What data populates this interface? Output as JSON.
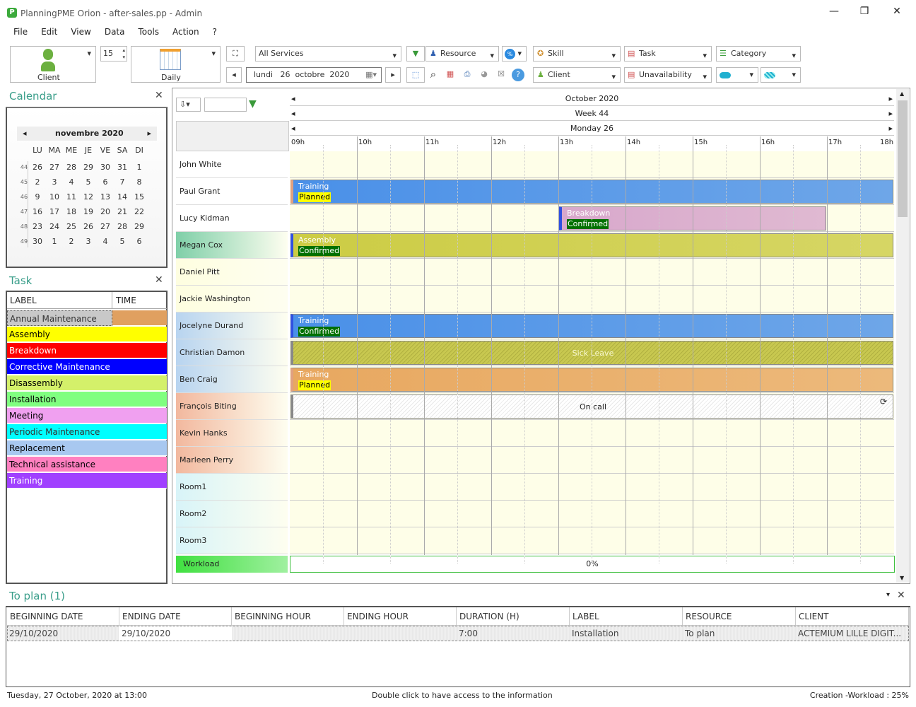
{
  "window": {
    "title": "PlanningPME Orion - after-sales.pp - Admin",
    "minimize": "—",
    "restore": "❐",
    "close": "✕"
  },
  "menu": [
    "File",
    "Edit",
    "View",
    "Data",
    "Tools",
    "Action",
    "?"
  ],
  "toolbar": {
    "client_label": "Client",
    "spin_value": "15",
    "view_label": "Daily",
    "services": "All Services",
    "resource": "Resource",
    "skill": "Skill",
    "task": "Task",
    "category": "Category",
    "client_filter": "Client",
    "unavailability": "Unavailability",
    "date": {
      "day_name": "lundi",
      "day": "26",
      "month": "octobre",
      "year": "2020"
    }
  },
  "calendar": {
    "title": "Calendar",
    "month_label": "novembre 2020",
    "weekdays": [
      "LU",
      "MA",
      "ME",
      "JE",
      "VE",
      "SA",
      "DI"
    ],
    "weeks": [
      {
        "n": "44",
        "d": [
          "26",
          "27",
          "28",
          "29",
          "30",
          "31",
          "1"
        ]
      },
      {
        "n": "45",
        "d": [
          "2",
          "3",
          "4",
          "5",
          "6",
          "7",
          "8"
        ]
      },
      {
        "n": "46",
        "d": [
          "9",
          "10",
          "11",
          "12",
          "13",
          "14",
          "15"
        ]
      },
      {
        "n": "47",
        "d": [
          "16",
          "17",
          "18",
          "19",
          "20",
          "21",
          "22"
        ]
      },
      {
        "n": "48",
        "d": [
          "23",
          "24",
          "25",
          "26",
          "27",
          "28",
          "29"
        ]
      },
      {
        "n": "49",
        "d": [
          "30",
          "1",
          "2",
          "3",
          "4",
          "5",
          "6"
        ]
      }
    ]
  },
  "task_panel": {
    "title": "Task",
    "col_label": "LABEL",
    "col_time": "TIME",
    "items": [
      {
        "label": "Annual Maintenance",
        "color": "#c8c8c8",
        "fg": "#333"
      },
      {
        "label": "Assembly",
        "color": "#ffff00",
        "fg": "#000"
      },
      {
        "label": "Breakdown",
        "color": "#ff0000",
        "fg": "#fff"
      },
      {
        "label": "Corrective Maintenance",
        "color": "#0000ff",
        "fg": "#fff"
      },
      {
        "label": "Disassembly",
        "color": "#d4f06a",
        "fg": "#000"
      },
      {
        "label": "Installation",
        "color": "#80ff80",
        "fg": "#000"
      },
      {
        "label": "Meeting",
        "color": "#f0a0f0",
        "fg": "#000"
      },
      {
        "label": "Periodic Maintenance",
        "color": "#00ffff",
        "fg": "#333"
      },
      {
        "label": "Replacement",
        "color": "#a8c8f0",
        "fg": "#000"
      },
      {
        "label": "Technical assistance",
        "color": "#ff80c0",
        "fg": "#000"
      },
      {
        "label": "Training",
        "color": "#a040ff",
        "fg": "#fff"
      }
    ]
  },
  "planning": {
    "month": "October 2020",
    "week": "Week 44",
    "day": "Monday 26",
    "hours": [
      "09h",
      "10h",
      "11h",
      "12h",
      "13h",
      "14h",
      "15h",
      "16h",
      "17h",
      "18h"
    ],
    "resources": [
      {
        "name": "John White",
        "bg": "#ffffff"
      },
      {
        "name": "Paul Grant",
        "bg": "#ffffff"
      },
      {
        "name": "Lucy Kidman",
        "bg": "#ffffff"
      },
      {
        "name": "Megan Cox",
        "bg": "#7fcfa8"
      },
      {
        "name": "Daniel Pitt",
        "bg": "#fefee0"
      },
      {
        "name": "Jackie Washington",
        "bg": "#fefee0"
      },
      {
        "name": "Jocelyne Durand",
        "bg": "#b8d4f0"
      },
      {
        "name": "Christian Damon",
        "bg": "#b8d4f0"
      },
      {
        "name": "Ben Craig",
        "bg": "#b8d4f0"
      },
      {
        "name": "François Biting",
        "bg": "#f2b89e"
      },
      {
        "name": "Kevin Hanks",
        "bg": "#f2b89e"
      },
      {
        "name": "Marleen Perry",
        "bg": "#f2b89e"
      },
      {
        "name": "Room1",
        "bg": "#d8f4f8"
      },
      {
        "name": "Room2",
        "bg": "#d8f4f8"
      },
      {
        "name": "Room3",
        "bg": "#d8f4f8"
      }
    ],
    "events": [
      {
        "row": 1,
        "start": 9,
        "end": 18,
        "label": "Training",
        "status": "Planned",
        "color": "#4a90e8",
        "status_bg": "#ffff00",
        "status_fg": "#000"
      },
      {
        "row": 2,
        "start": 13,
        "end": 17,
        "label": "Breakdown",
        "status": "Confirmed",
        "color": "#d8a8cc",
        "status_bg": "#007000",
        "status_fg": "#fff"
      },
      {
        "row": 3,
        "start": 9,
        "end": 18,
        "label": "Assembly",
        "status": "Confirmed",
        "color": "#cccc44",
        "status_bg": "#007000",
        "status_fg": "#fff"
      },
      {
        "row": 6,
        "start": 9,
        "end": 18,
        "label": "Training",
        "status": "Confirmed",
        "color": "#4a90e8",
        "status_bg": "#007000",
        "status_fg": "#fff"
      },
      {
        "row": 7,
        "start": 9,
        "end": 18,
        "label": "Sick Leave",
        "status": "",
        "color": "#c8c850",
        "hatched": true
      },
      {
        "row": 8,
        "start": 9,
        "end": 18,
        "label": "Training",
        "status": "Planned",
        "color": "#e8a860",
        "status_bg": "#ffff00",
        "status_fg": "#000"
      },
      {
        "row": 9,
        "start": 9,
        "end": 18,
        "label": "On call",
        "status": "",
        "color": "#ffffff",
        "hatched": true
      }
    ],
    "workload_label": "Workload",
    "workload_value": "0%"
  },
  "to_plan": {
    "title": "To plan (1)",
    "columns": [
      "BEGINNING DATE",
      "ENDING DATE",
      "BEGINNING HOUR",
      "ENDING HOUR",
      "DURATION (H)",
      "LABEL",
      "RESOURCE",
      "CLIENT"
    ],
    "rows": [
      [
        "29/10/2020",
        "29/10/2020",
        "",
        "",
        "7:00",
        "Installation",
        "To plan",
        "ACTEMIUM LILLE DIGIT..."
      ]
    ]
  },
  "status": {
    "left": "Tuesday, 27 October, 2020 at 13:00",
    "center": "Double click to have access to the information",
    "right": "Creation -Workload : 25%"
  }
}
